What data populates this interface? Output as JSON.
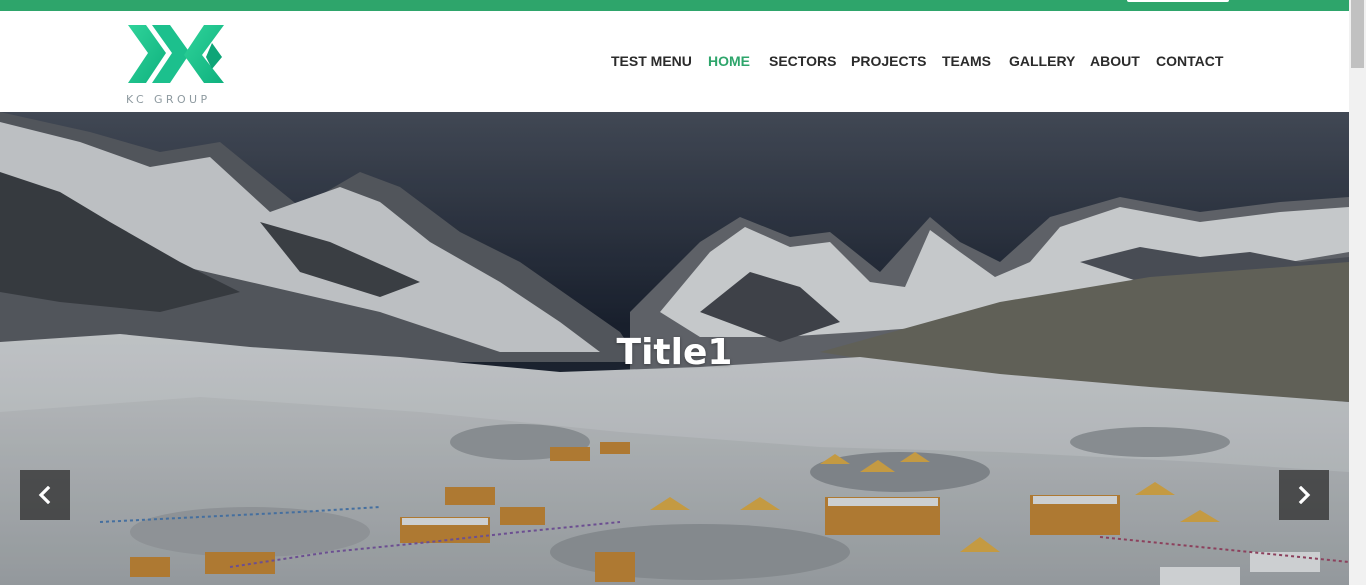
{
  "brand": {
    "logo_text": "KC GROUP",
    "primary_color": "#2ea56b"
  },
  "nav": {
    "items": [
      {
        "label": "TEST MENU",
        "active": false
      },
      {
        "label": "HOME",
        "active": true
      },
      {
        "label": "SECTORS",
        "active": false
      },
      {
        "label": "PROJECTS",
        "active": false
      },
      {
        "label": "TEAMS",
        "active": false
      },
      {
        "label": "GALLERY",
        "active": false
      },
      {
        "label": "ABOUT",
        "active": false
      },
      {
        "label": "CONTACT",
        "active": false
      }
    ]
  },
  "slider": {
    "title": "Title1",
    "prev_icon": "chevron-left-icon",
    "next_icon": "chevron-right-icon"
  }
}
